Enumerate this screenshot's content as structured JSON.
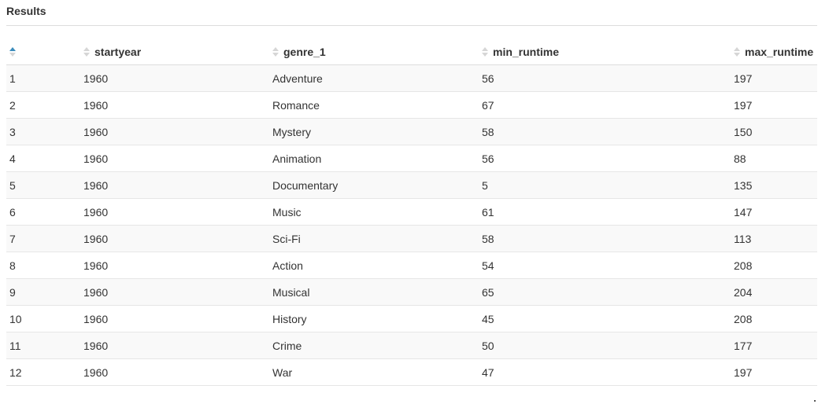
{
  "title": "Results",
  "columns": [
    {
      "label": "",
      "sort_active": true
    },
    {
      "label": "startyear",
      "sort_active": false
    },
    {
      "label": "genre_1",
      "sort_active": false
    },
    {
      "label": "min_runtime",
      "sort_active": false
    },
    {
      "label": "max_runtime",
      "sort_active": false
    }
  ],
  "rows": [
    [
      "1",
      "1960",
      "Adventure",
      "56",
      "197"
    ],
    [
      "2",
      "1960",
      "Romance",
      "67",
      "197"
    ],
    [
      "3",
      "1960",
      "Mystery",
      "58",
      "150"
    ],
    [
      "4",
      "1960",
      "Animation",
      "56",
      "88"
    ],
    [
      "5",
      "1960",
      "Documentary",
      "5",
      "135"
    ],
    [
      "6",
      "1960",
      "Music",
      "61",
      "147"
    ],
    [
      "7",
      "1960",
      "Sci-Fi",
      "58",
      "113"
    ],
    [
      "8",
      "1960",
      "Action",
      "54",
      "208"
    ],
    [
      "9",
      "1960",
      "Musical",
      "65",
      "204"
    ],
    [
      "10",
      "1960",
      "History",
      "45",
      "208"
    ],
    [
      "11",
      "1960",
      "Crime",
      "50",
      "177"
    ],
    [
      "12",
      "1960",
      "War",
      "47",
      "197"
    ]
  ],
  "colors": {
    "sort_active": "#3c8dbc",
    "sort_inactive": "#d6d6d6",
    "stripe": "#f9f9f9"
  },
  "icons": {
    "sort": "sort-icon"
  }
}
